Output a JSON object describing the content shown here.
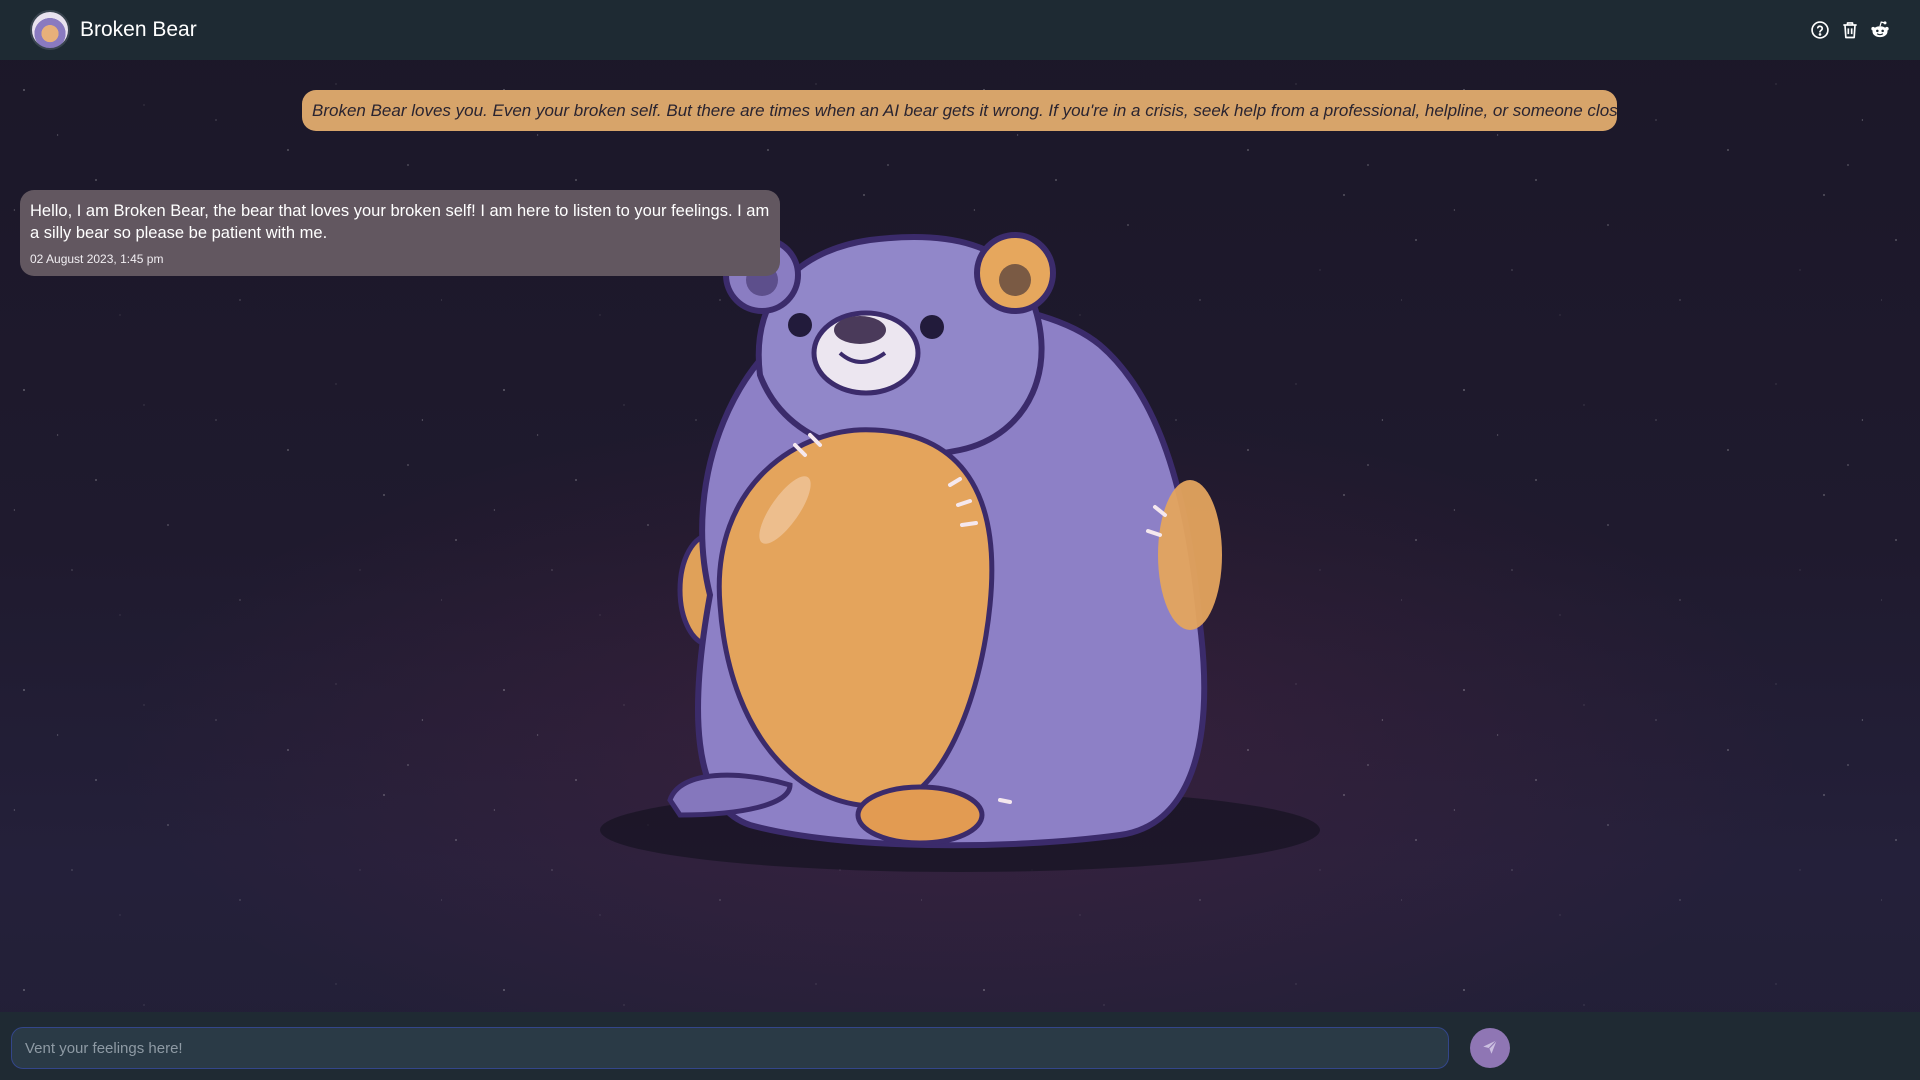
{
  "header": {
    "title": "Broken Bear",
    "icons": [
      "help-circle-icon",
      "trash-icon",
      "reddit-icon"
    ]
  },
  "disclaimer": {
    "text": "Broken Bear loves you. Even your broken self. But there are times when an AI bear gets it wrong. If you're in a crisis, seek help from a professional, helpline, or someone close!"
  },
  "messages": [
    {
      "text": "Hello, I am Broken Bear, the bear that loves your broken self! I am here to listen to your feelings. I am a silly bear so please be patient with me.",
      "time": "02 August 2023, 1:45 pm"
    }
  ],
  "composer": {
    "placeholder": "Vent your feelings here!",
    "value": ""
  },
  "colors": {
    "header_bg": "#1e2a33",
    "disclaimer_bg": "#d7a46a",
    "message_bg": "#625760",
    "send_button": "#8f76b4",
    "bear_body": "#8c80c4",
    "bear_patch": "#e6a45c"
  }
}
